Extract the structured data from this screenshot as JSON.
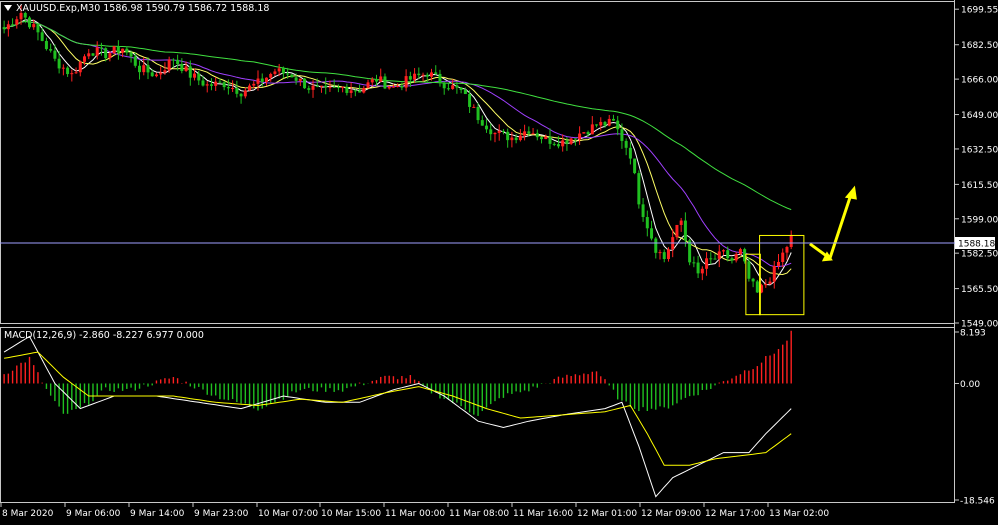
{
  "colors": {
    "background": "#000000",
    "frame": "#c8c8c8",
    "bull": "#ff2020",
    "bear": "#20c020",
    "ma_fast": "#ffffff",
    "ma_mid": "#ffff66",
    "ma_slow": "#a040ff",
    "ma_long": "#40e040",
    "price_line": "#a0a0ff",
    "annotation": "#ffff00",
    "text": "#ffffff",
    "macd_pos": "#ff2020",
    "macd_neg": "#20c020",
    "macd_line": "#ffffff",
    "signal_line": "#ffff00"
  },
  "main": {
    "header_icon": "triangle-down-icon",
    "header_text": "XAUUSD.Exp,M30  1586.98 1590.79 1586.72 1588.18",
    "price_label": "1588.18",
    "price_ticks": [
      "1699.55",
      "1682.50",
      "1666.00",
      "1649.00",
      "1632.50",
      "1615.50",
      "1599.00",
      "1582.50",
      "1565.50",
      "1549.00"
    ]
  },
  "macd": {
    "header_text": "MACD(12,26,9) -2.860 -8.227 6.977 0.000",
    "ticks": [
      "8.193",
      "0.00",
      "-18.546"
    ]
  },
  "time_labels": [
    "8 Mar 2020",
    "9 Mar 06:00",
    "9 Mar 14:00",
    "9 Mar 23:00",
    "10 Mar 07:00",
    "10 Mar 15:00",
    "11 Mar 00:00",
    "11 Mar 08:00",
    "11 Mar 16:00",
    "12 Mar 01:00",
    "12 Mar 09:00",
    "12 Mar 17:00",
    "13 Mar 02:00"
  ],
  "chart_data": {
    "type": "candlestick",
    "symbol": "XAUUSD.Exp",
    "timeframe": "M30",
    "last_price": 1588.18,
    "ylim": [
      1549.0,
      1703.0
    ],
    "price_path": [
      [
        0,
        1690
      ],
      [
        4,
        1698
      ],
      [
        8,
        1688
      ],
      [
        12,
        1675
      ],
      [
        16,
        1668
      ],
      [
        20,
        1680
      ],
      [
        24,
        1678
      ],
      [
        28,
        1681
      ],
      [
        32,
        1671
      ],
      [
        36,
        1668
      ],
      [
        40,
        1676
      ],
      [
        44,
        1668
      ],
      [
        48,
        1663
      ],
      [
        52,
        1664
      ],
      [
        56,
        1660
      ],
      [
        60,
        1664
      ],
      [
        64,
        1670
      ],
      [
        68,
        1668
      ],
      [
        72,
        1662
      ],
      [
        76,
        1660
      ],
      [
        80,
        1662
      ],
      [
        84,
        1661
      ],
      [
        88,
        1666
      ],
      [
        92,
        1662
      ],
      [
        96,
        1666
      ],
      [
        100,
        1669
      ],
      [
        104,
        1664
      ],
      [
        108,
        1660
      ],
      [
        112,
        1648
      ],
      [
        116,
        1640
      ],
      [
        120,
        1638
      ],
      [
        124,
        1642
      ],
      [
        128,
        1637
      ],
      [
        132,
        1636
      ],
      [
        136,
        1640
      ],
      [
        140,
        1644
      ],
      [
        144,
        1645
      ],
      [
        148,
        1630
      ],
      [
        150,
        1608
      ],
      [
        152,
        1596
      ],
      [
        154,
        1585
      ],
      [
        156,
        1580
      ],
      [
        158,
        1590
      ],
      [
        160,
        1598
      ],
      [
        162,
        1580
      ],
      [
        164,
        1572
      ],
      [
        166,
        1578
      ],
      [
        168,
        1580
      ],
      [
        170,
        1582
      ],
      [
        172,
        1579
      ],
      [
        174,
        1583
      ],
      [
        176,
        1570
      ],
      [
        178,
        1563
      ],
      [
        180,
        1568
      ],
      [
        182,
        1574
      ],
      [
        184,
        1582
      ],
      [
        186,
        1590
      ]
    ],
    "macd": {
      "values": [
        -2.86,
        -8.227,
        6.977
      ],
      "ylim": [
        -18.546,
        8.193
      ],
      "hist_path": [
        [
          0,
          1.5
        ],
        [
          6,
          4
        ],
        [
          10,
          -1
        ],
        [
          14,
          -5
        ],
        [
          18,
          -4
        ],
        [
          24,
          -1
        ],
        [
          30,
          -1
        ],
        [
          40,
          1
        ],
        [
          50,
          -2
        ],
        [
          60,
          -4
        ],
        [
          70,
          -1
        ],
        [
          80,
          -1
        ],
        [
          90,
          1
        ],
        [
          96,
          1
        ],
        [
          100,
          -1
        ],
        [
          106,
          -3
        ],
        [
          112,
          -5
        ],
        [
          118,
          -2
        ],
        [
          124,
          -1
        ],
        [
          132,
          1
        ],
        [
          140,
          2
        ],
        [
          146,
          -3
        ],
        [
          150,
          -4
        ],
        [
          156,
          -4
        ],
        [
          162,
          -2
        ],
        [
          166,
          -1
        ],
        [
          172,
          1
        ],
        [
          178,
          3
        ],
        [
          184,
          6
        ],
        [
          186,
          8
        ]
      ],
      "macd_path": [
        [
          0,
          5
        ],
        [
          6,
          7.5
        ],
        [
          12,
          0
        ],
        [
          18,
          -4
        ],
        [
          26,
          -2
        ],
        [
          36,
          -2
        ],
        [
          46,
          -3
        ],
        [
          56,
          -4
        ],
        [
          66,
          -2
        ],
        [
          76,
          -3
        ],
        [
          84,
          -3
        ],
        [
          92,
          -1
        ],
        [
          98,
          0
        ],
        [
          104,
          -2
        ],
        [
          112,
          -6
        ],
        [
          118,
          -7
        ],
        [
          124,
          -6
        ],
        [
          132,
          -5
        ],
        [
          142,
          -4
        ],
        [
          146,
          -3
        ],
        [
          150,
          -10
        ],
        [
          154,
          -18
        ],
        [
          158,
          -15
        ],
        [
          164,
          -13
        ],
        [
          170,
          -11
        ],
        [
          176,
          -11
        ],
        [
          180,
          -8
        ],
        [
          186,
          -4
        ]
      ],
      "signal_path": [
        [
          0,
          4
        ],
        [
          8,
          5
        ],
        [
          14,
          1
        ],
        [
          20,
          -2
        ],
        [
          30,
          -2
        ],
        [
          40,
          -2
        ],
        [
          50,
          -3
        ],
        [
          60,
          -3.5
        ],
        [
          70,
          -2.5
        ],
        [
          80,
          -3
        ],
        [
          90,
          -1.5
        ],
        [
          98,
          -0.5
        ],
        [
          106,
          -2
        ],
        [
          114,
          -4
        ],
        [
          122,
          -5.5
        ],
        [
          132,
          -5
        ],
        [
          142,
          -4.5
        ],
        [
          148,
          -3.5
        ],
        [
          152,
          -8
        ],
        [
          156,
          -13
        ],
        [
          162,
          -13
        ],
        [
          168,
          -12
        ],
        [
          174,
          -11.5
        ],
        [
          180,
          -11
        ],
        [
          186,
          -8
        ]
      ]
    }
  }
}
